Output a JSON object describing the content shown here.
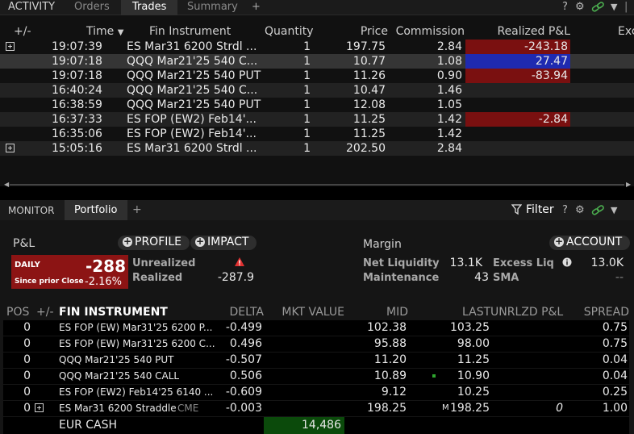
{
  "top_tabs": {
    "activity": "ACTIVITY",
    "orders": "Orders",
    "trades": "Trades",
    "summary": "Summary",
    "add": "+"
  },
  "window_controls": {
    "help": "?",
    "settings": "⚙",
    "link": "🔗",
    "menu": "▼"
  },
  "trades": {
    "headers": {
      "expand": "+/-",
      "time": "Time",
      "sort_arrow": "▼",
      "instrument": "Fin Instrument",
      "quantity": "Quantity",
      "price": "Price",
      "commission": "Commission",
      "realized_pl": "Realized P&L",
      "exchange": "Exc"
    },
    "rows": [
      {
        "time": "19:07:39",
        "instrument": "ES Mar31 6200 Strdl ...",
        "qty": "1",
        "price": "197.75",
        "commission": "2.84",
        "pl": "-243.18",
        "pl_color": "red",
        "expander": true
      },
      {
        "time": "19:07:18",
        "instrument": "QQQ Mar21'25 540 C...",
        "qty": "1",
        "price": "10.77",
        "commission": "1.08",
        "pl": "27.47",
        "pl_color": "blue",
        "expander": false
      },
      {
        "time": "19:07:18",
        "instrument": "QQQ Mar21'25 540 PUT",
        "qty": "1",
        "price": "11.26",
        "commission": "0.90",
        "pl": "-83.94",
        "pl_color": "red",
        "expander": false
      },
      {
        "time": "16:40:24",
        "instrument": "QQQ Mar21'25 540 C...",
        "qty": "1",
        "price": "10.47",
        "commission": "1.46",
        "pl": "",
        "pl_color": "",
        "expander": false
      },
      {
        "time": "16:38:59",
        "instrument": "QQQ Mar21'25 540 PUT",
        "qty": "1",
        "price": "12.08",
        "commission": "1.05",
        "pl": "",
        "pl_color": "",
        "expander": false
      },
      {
        "time": "16:37:33",
        "instrument": "ES FOP (EW2) Feb14'...",
        "qty": "1",
        "price": "11.25",
        "commission": "1.42",
        "pl": "-2.84",
        "pl_color": "red",
        "expander": false
      },
      {
        "time": "16:35:06",
        "instrument": "ES FOP (EW2) Feb14'...",
        "qty": "1",
        "price": "11.25",
        "commission": "1.42",
        "pl": "",
        "pl_color": "",
        "expander": false
      },
      {
        "time": "15:05:16",
        "instrument": "ES Mar31 6200 Strdl ...",
        "qty": "1",
        "price": "202.50",
        "commission": "2.84",
        "pl": "",
        "pl_color": "",
        "expander": true
      }
    ]
  },
  "monitor_tabs": {
    "monitor": "MONITOR",
    "portfolio": "Portfolio",
    "add": "+",
    "filter": "Filter"
  },
  "pnl": {
    "title": "P&L",
    "profile_btn": "PROFILE",
    "impact_btn": "IMPACT",
    "daily_label": "DAILY",
    "daily_value": "-288",
    "since_label": "Since prior Close",
    "since_value": "-2.16%",
    "unrealized_label": "Unrealized",
    "unrealized_value": "",
    "realized_label": "Realized",
    "realized_value": "-287.9"
  },
  "margin": {
    "title": "Margin",
    "account_btn": "ACCOUNT",
    "net_liq_label": "Net Liquidity",
    "net_liq_value": "13.1K",
    "excess_label": "Excess Liq",
    "excess_value": "13.0K",
    "maint_label": "Maintenance",
    "maint_value": "43",
    "sma_label": "SMA",
    "sma_value": "--"
  },
  "portfolio": {
    "headers": {
      "pos": "POS",
      "expand": "+/-",
      "instrument": "FIN INSTRUMENT",
      "delta": "DELTA",
      "mkt_value": "MKT VALUE",
      "mid": "MID",
      "last": "LAST",
      "unrlzd": "UNRLZD P&L",
      "spread": "SPREAD"
    },
    "rows": [
      {
        "pos": "0",
        "instrument": "ES FOP (EW) Mar31'25 6200 P...",
        "delta": "-0.499",
        "mid": "102.38",
        "last": "103.25",
        "unrlzd": "",
        "spread": "0.75"
      },
      {
        "pos": "0",
        "instrument": "ES FOP (EW) Mar31'25 6200 C...",
        "delta": "0.496",
        "mid": "95.88",
        "last": "98.00",
        "unrlzd": "",
        "spread": "0.75"
      },
      {
        "pos": "0",
        "instrument": "QQQ Mar21'25 540 PUT",
        "delta": "-0.507",
        "mid": "11.20",
        "last": "11.25",
        "unrlzd": "",
        "spread": "0.04"
      },
      {
        "pos": "0",
        "instrument": "QQQ Mar21'25 540 CALL",
        "delta": "0.506",
        "mid": "10.89",
        "last": "10.90",
        "unrlzd": "",
        "spread": "0.04"
      },
      {
        "pos": "0",
        "instrument": "ES FOP (EW2) Feb14'25 6140 ...",
        "delta": "-0.609",
        "mid": "9.12",
        "last": "10.25",
        "unrlzd": "",
        "spread": "0.25"
      },
      {
        "pos": "0",
        "instrument": "ES Mar31 6200 Straddle",
        "exchange": "CME",
        "delta": "-0.003",
        "mid": "198.25",
        "last_prefix": "M",
        "last": "198.25",
        "unrlzd": "0",
        "spread": "1.00"
      }
    ],
    "cash": {
      "label": "EUR CASH",
      "value": "14,486"
    }
  }
}
